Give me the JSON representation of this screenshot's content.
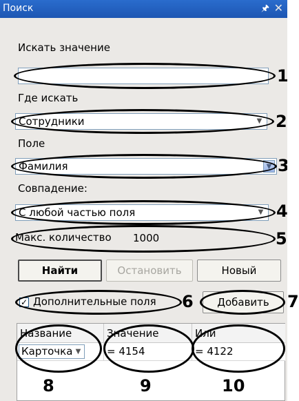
{
  "window": {
    "title": "Поиск",
    "pin_icon": "pin-icon",
    "close_icon": "close-icon"
  },
  "search_value": {
    "label": "Искать значение",
    "value": ""
  },
  "where": {
    "label": "Где искать",
    "selected": "Сотрудники"
  },
  "field": {
    "label": "Поле",
    "selected": "Фамилия"
  },
  "match": {
    "label": "Совпадение:",
    "selected": "С любой частью поля"
  },
  "max_count": {
    "label": "Макс. количество",
    "value": "1000"
  },
  "buttons": {
    "find": "Найти",
    "stop": "Остановить",
    "new": "Новый",
    "add": "Добавить"
  },
  "extra_fields": {
    "label": "Дополнительные поля",
    "checked": true,
    "check_mark": "✓"
  },
  "table": {
    "columns": [
      "Название",
      "Значение",
      "Или"
    ],
    "row": {
      "name": "Карточка",
      "value": "= 4154",
      "or": "= 4122"
    }
  },
  "callouts": [
    "1",
    "2",
    "3",
    "4",
    "5",
    "6",
    "7",
    "8",
    "9",
    "10"
  ],
  "colors": {
    "title_bar": "#1d56b3",
    "panel_bg": "#ebe9e6",
    "field_border": "#7f9db9"
  }
}
